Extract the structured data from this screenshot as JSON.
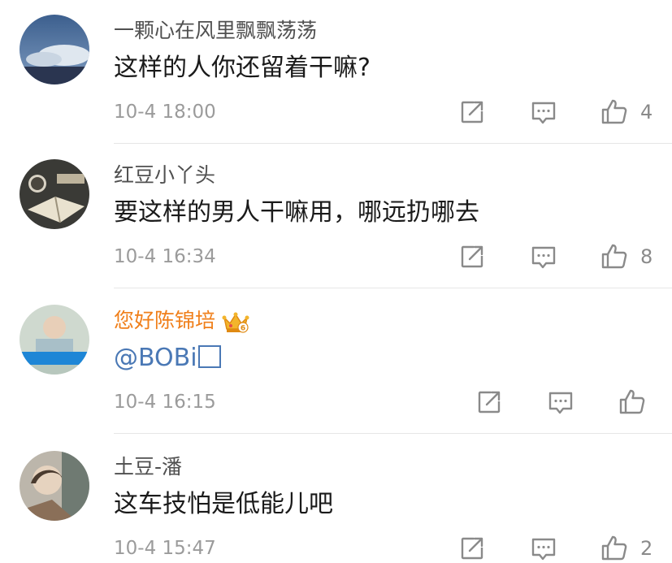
{
  "comments": [
    {
      "username": "一颗心在风里飘飘荡荡",
      "text": "这样的人你还留着干嘛?",
      "time": "10-4 18:00",
      "likes": "4",
      "vip": false
    },
    {
      "username": "红豆小丫头",
      "text": "要这样的男人干嘛用，哪远扔哪去",
      "time": "10-4 16:34",
      "likes": "8",
      "vip": false
    },
    {
      "username": "您好陈锦培",
      "text": "@BOBi",
      "time": "10-4 16:15",
      "likes": "",
      "vip": true,
      "badge_icon": "crown-vip-badge-icon",
      "badge_text": "6"
    },
    {
      "username": "土豆-潘",
      "text": "这车技怕是低能儿吧",
      "time": "10-4 15:47",
      "likes": "2",
      "vip": false
    }
  ],
  "icons": {
    "share": "share-icon",
    "reply": "comment-icon",
    "like": "thumbs-up-icon"
  },
  "colors": {
    "username": "#505050",
    "vip_username": "#f07f1a",
    "mention": "#4a78b5",
    "meta": "#9b9b9b"
  }
}
